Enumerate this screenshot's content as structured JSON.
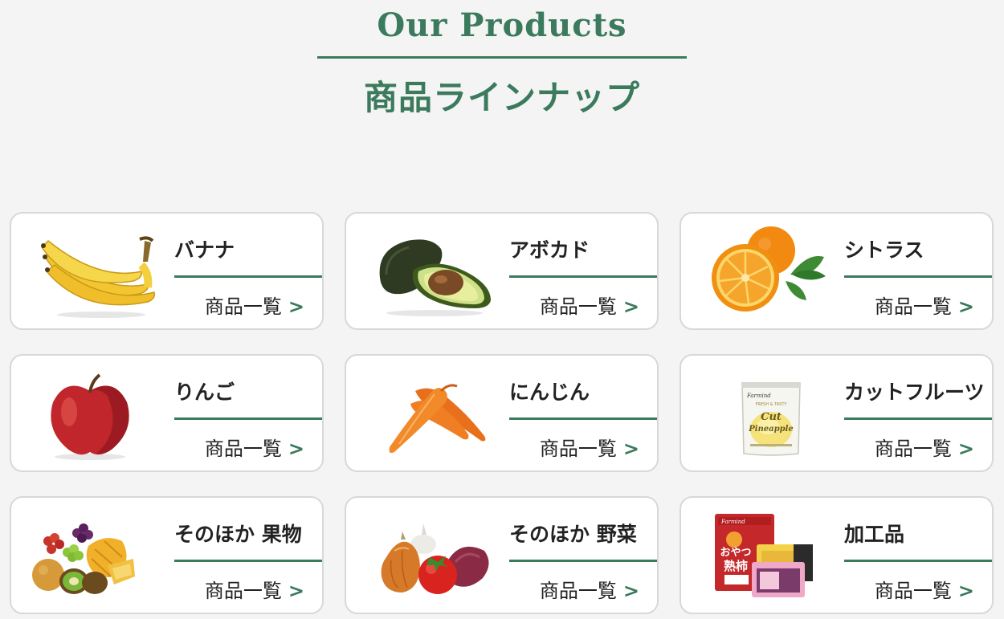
{
  "header": {
    "title_en": "Our Products",
    "title_ja": "商品ラインナップ"
  },
  "colors": {
    "accent": "#3b7a5d",
    "background": "#f4f4f4",
    "card": "#ffffff",
    "card_border": "#d8d8d8"
  },
  "products": [
    {
      "name": "バナナ",
      "link": "商品一覧",
      "chevron": ">",
      "icon": "banana-icon"
    },
    {
      "name": "アボカド",
      "link": "商品一覧",
      "chevron": ">",
      "icon": "avocado-icon"
    },
    {
      "name": "シトラス",
      "link": "商品一覧",
      "chevron": ">",
      "icon": "orange-icon"
    },
    {
      "name": "りんご",
      "link": "商品一覧",
      "chevron": ">",
      "icon": "apple-icon"
    },
    {
      "name": "にんじん",
      "link": "商品一覧",
      "chevron": ">",
      "icon": "carrot-icon"
    },
    {
      "name": "カットフルーツ",
      "link": "商品一覧",
      "chevron": ">",
      "icon": "cut-pineapple-pack-icon"
    },
    {
      "name": "そのほか 果物",
      "link": "商品一覧",
      "chevron": ">",
      "icon": "mixed-fruits-icon"
    },
    {
      "name": "そのほか 野菜",
      "link": "商品一覧",
      "chevron": ">",
      "icon": "mixed-vegetables-icon"
    },
    {
      "name": "加工品",
      "link": "商品一覧",
      "chevron": ">",
      "icon": "processed-goods-icon"
    }
  ],
  "packaging": {
    "pineapple_brand": "Farmind",
    "pineapple_line1": "FRESH & TASTY",
    "pineapple_line2": "Cut",
    "pineapple_line3": "Pineapple",
    "processed_brand": "Farmind",
    "processed_label1": "おやつ",
    "processed_label2": "熟柿"
  }
}
